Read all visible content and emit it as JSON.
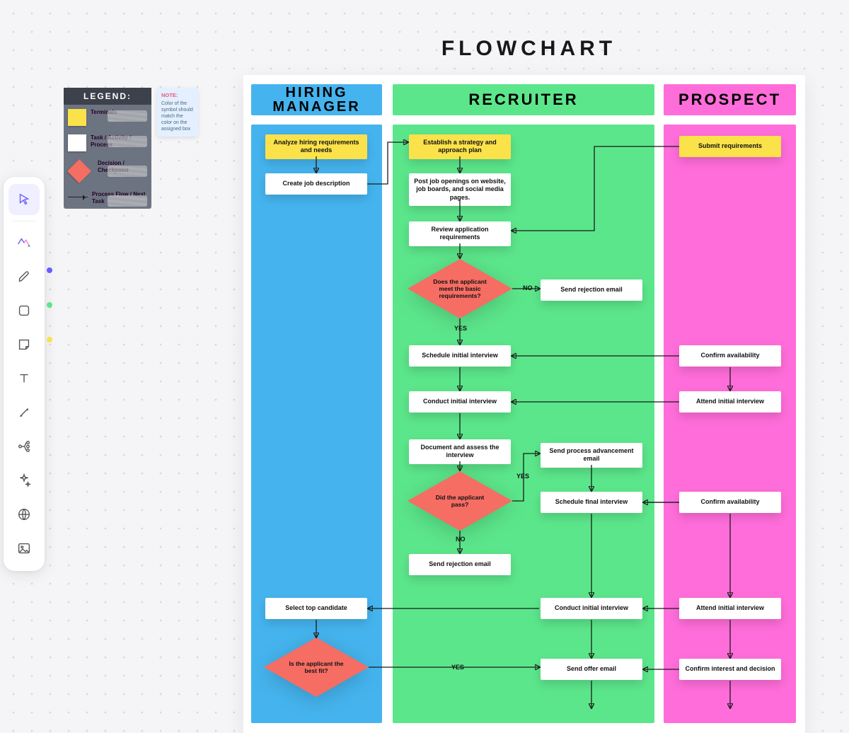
{
  "title": "FLOWCHART",
  "legend": {
    "header": "LEGEND:",
    "items": [
      {
        "label": "Terminals"
      },
      {
        "label": "Task / Activity / Process"
      },
      {
        "label": "Decision / Checkpoint"
      },
      {
        "label": "Process Flow / Next Task"
      }
    ]
  },
  "note": {
    "header": "NOTE:",
    "body": "Color of the symbol should match the color on the assigned box"
  },
  "lanes": {
    "hm": "HIRING MANAGER",
    "rc": "RECRUITER",
    "pr": "PROSPECT"
  },
  "nodes": {
    "hm_analyze": "Analyze hiring requirements and needs",
    "hm_jobdesc": "Create job description",
    "hm_select": "Select top candidate",
    "rc_strategy": "Establish a strategy and approach plan",
    "rc_post": "Post job openings on website, job boards, and social media pages.",
    "rc_review": "Review application requirements",
    "rc_schedule": "Schedule initial interview",
    "rc_conduct": "Conduct initial interview",
    "rc_document": "Document and assess the interview",
    "rc_reject1": "Send rejection email",
    "rc_reject2": "Send rejection email",
    "rc_advance": "Send process advancement email",
    "rc_schedfinal": "Schedule final interview",
    "rc_conduct2": "Conduct initial interview",
    "rc_offer": "Send offer email",
    "pr_submit": "Submit requirements",
    "pr_confirm1": "Confirm availability",
    "pr_attend1": "Attend initial interview",
    "pr_confirm2": "Confirm availability",
    "pr_attend2": "Attend initial interview",
    "pr_confirm3": "Confirm interest and decision"
  },
  "decisions": {
    "d_basic": "Does the applicant meet the basic requirements?",
    "d_pass": "Did the applicant pass?",
    "d_fit": "Is the applicant the best fit?"
  },
  "labels": {
    "yes": "YES",
    "no": "NO"
  },
  "toolbar": {
    "items": [
      {
        "name": "select"
      },
      {
        "name": "ai-generate"
      },
      {
        "name": "draw"
      },
      {
        "name": "shape"
      },
      {
        "name": "sticky"
      },
      {
        "name": "text"
      },
      {
        "name": "connector"
      },
      {
        "name": "mindmap"
      },
      {
        "name": "magic"
      },
      {
        "name": "web"
      },
      {
        "name": "image"
      }
    ]
  }
}
